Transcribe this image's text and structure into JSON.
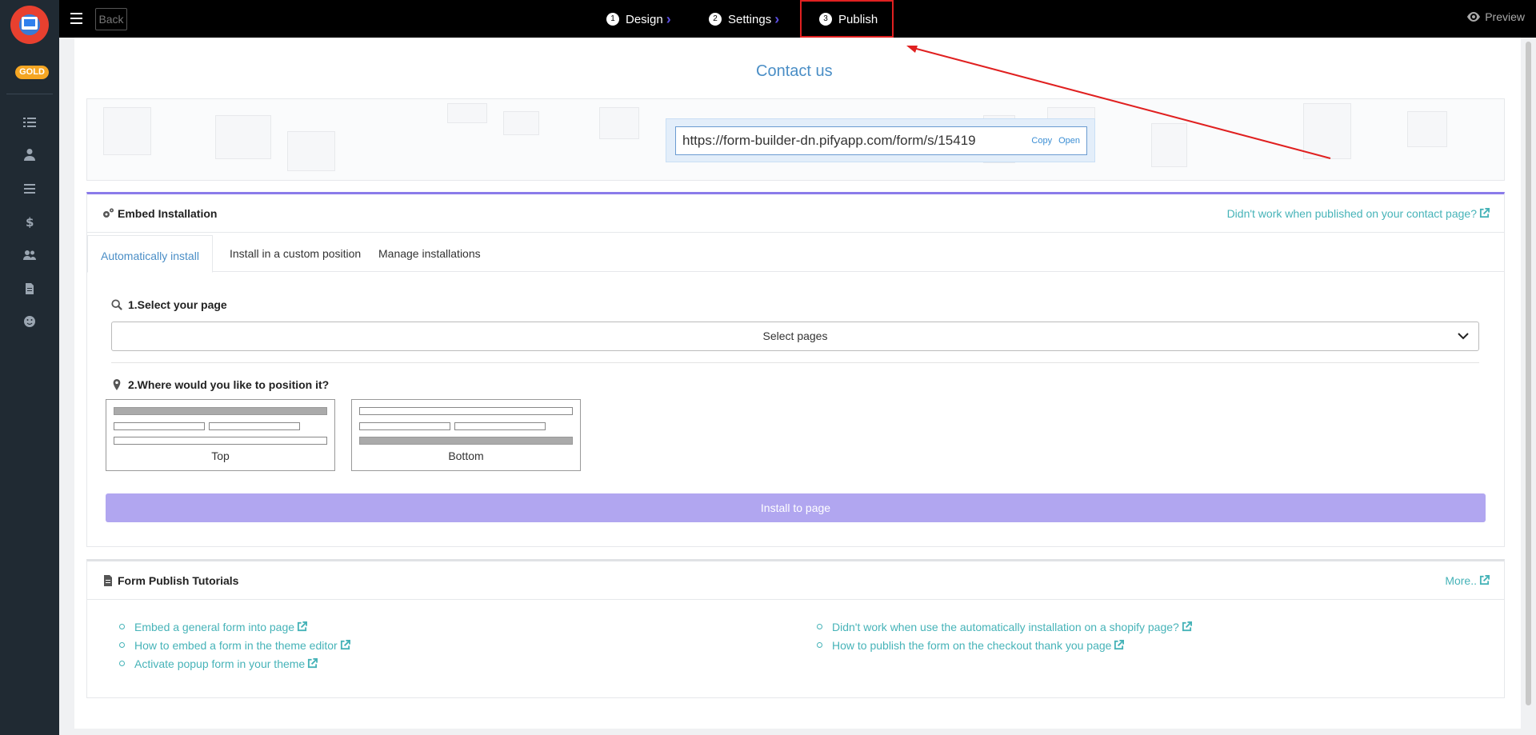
{
  "sidebar": {
    "badge": "GOLD",
    "icons": [
      "list-icon",
      "user-icon",
      "menu-icon",
      "dollar-icon",
      "users-icon",
      "file-icon",
      "smile-icon"
    ]
  },
  "topbar": {
    "back_label": "Back",
    "steps": [
      {
        "num": "1",
        "label": "Design"
      },
      {
        "num": "2",
        "label": "Settings"
      },
      {
        "num": "3",
        "label": "Publish"
      }
    ],
    "preview_label": "Preview",
    "accent": "#5b4ee0"
  },
  "form": {
    "title": "Contact us",
    "url": "https://form-builder-dn.pifyapp.com/form/s/15419",
    "copy_label": "Copy",
    "open_label": "Open"
  },
  "embed": {
    "title": "Embed Installation",
    "help_link": "Didn't work when published on your contact page?",
    "tabs": [
      "Automatically install",
      "Install in a custom position",
      "Manage installations"
    ],
    "step1_label": "1.Select your page",
    "select_placeholder": "Select pages",
    "step2_label": "2.Where would you like to position it?",
    "positions": [
      "Top",
      "Bottom"
    ],
    "install_button": "Install to page",
    "button_color": "#b1a6f0"
  },
  "tutorials": {
    "title": "Form Publish Tutorials",
    "more_link": "More..",
    "left": [
      "Embed a general form into page",
      "How to embed a form in the theme editor",
      "Activate popup form in your theme"
    ],
    "right": [
      "Didn't work when use the automatically installation on a shopify page?",
      "How to publish the form on the checkout thank you page"
    ],
    "link_color": "#46b3b8"
  }
}
